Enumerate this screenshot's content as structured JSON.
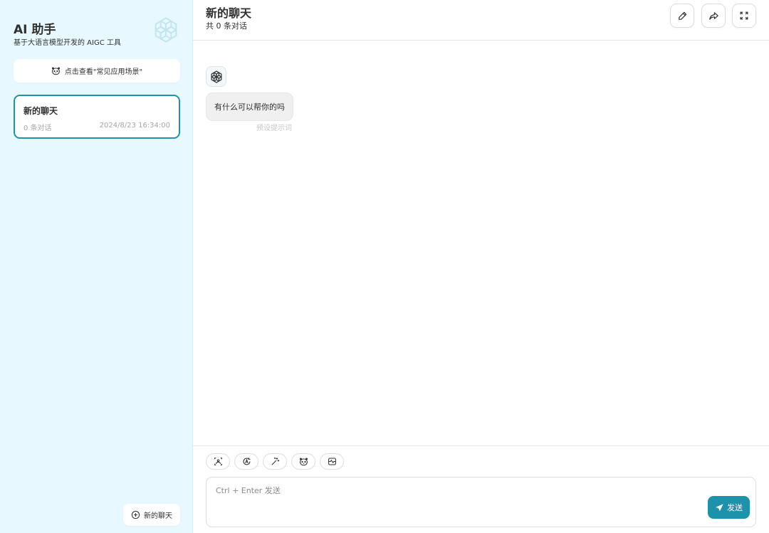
{
  "sidebar": {
    "title": "AI 助手",
    "subtitle": "基于大语言模型开发的 AIGC 工具",
    "logo_icon": "openai-logo-icon",
    "scenes_button": {
      "icon": "mask-icon",
      "label": "点击查看\"常见应用场景\""
    },
    "chats": [
      {
        "title": "新的聊天",
        "count": "0 条对话",
        "time": "2024/8/23 16:34:00",
        "selected": true
      }
    ],
    "new_chat_button": {
      "icon": "plus-circle-icon",
      "label": "新的聊天"
    }
  },
  "header": {
    "title": "新的聊天",
    "subtitle": "共 0 条对话",
    "actions": [
      {
        "name": "edit",
        "icon": "pencil-icon"
      },
      {
        "name": "share",
        "icon": "share-icon"
      },
      {
        "name": "maximize",
        "icon": "maximize-icon"
      }
    ]
  },
  "messages": [
    {
      "role": "assistant",
      "avatar": "openai-logo-icon",
      "text": "有什么可以帮你的吗",
      "hint": "预设提示词"
    }
  ],
  "composer": {
    "tools": [
      {
        "name": "theme",
        "icon": "image-theme-icon"
      },
      {
        "name": "auto",
        "icon": "auto-mode-icon"
      },
      {
        "name": "prompt",
        "icon": "magic-wand-icon"
      },
      {
        "name": "mask",
        "icon": "mask-icon"
      },
      {
        "name": "model",
        "icon": "model-box-icon"
      }
    ],
    "placeholder": "Ctrl + Enter 发送",
    "send_label": "发送",
    "send_icon": "send-icon"
  },
  "colors": {
    "sidebar_bg": "#e7f8ff",
    "accent": "#1d93ab",
    "bubble_bg": "#f0f0f0"
  }
}
